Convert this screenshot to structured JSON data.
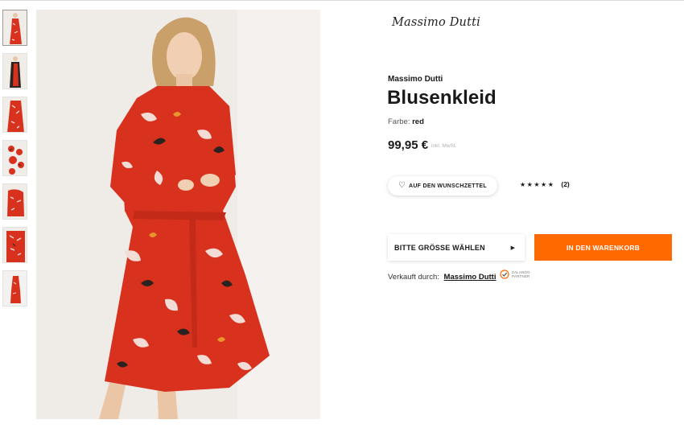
{
  "gallery": {
    "thumbnails": [
      {
        "label": "Produktbild 1",
        "active": true
      },
      {
        "label": "Produktbild 2",
        "active": false
      },
      {
        "label": "Produktbild 3",
        "active": false
      },
      {
        "label": "Produktbild 4",
        "active": false
      },
      {
        "label": "Produktbild 5",
        "active": false
      },
      {
        "label": "Produktbild 6",
        "active": false
      },
      {
        "label": "Produktbild 7",
        "active": false
      }
    ]
  },
  "product": {
    "brand_logo": "Massimo Dutti",
    "brand": "Massimo Dutti",
    "title": "Blusenkleid",
    "color_label": "Farbe:",
    "color_value": "red",
    "price": "99,95 €",
    "vat_note": "inkl. MwSt."
  },
  "actions": {
    "wishlist_label": "AUF DEN WUNSCHZETTEL",
    "rating_stars": "★★★★★",
    "rating_count": "(2)",
    "size_select_label": "BITTE GRÖSSE WÄHLEN",
    "add_to_cart_label": "IN DEN WARENKORB"
  },
  "seller": {
    "label": "Verkauft durch:",
    "name": "Massimo Dutti",
    "badge_text": "ZALANDO\nPARTNER"
  },
  "colors": {
    "accent": "#ff6900",
    "dress": "#d8321f"
  }
}
